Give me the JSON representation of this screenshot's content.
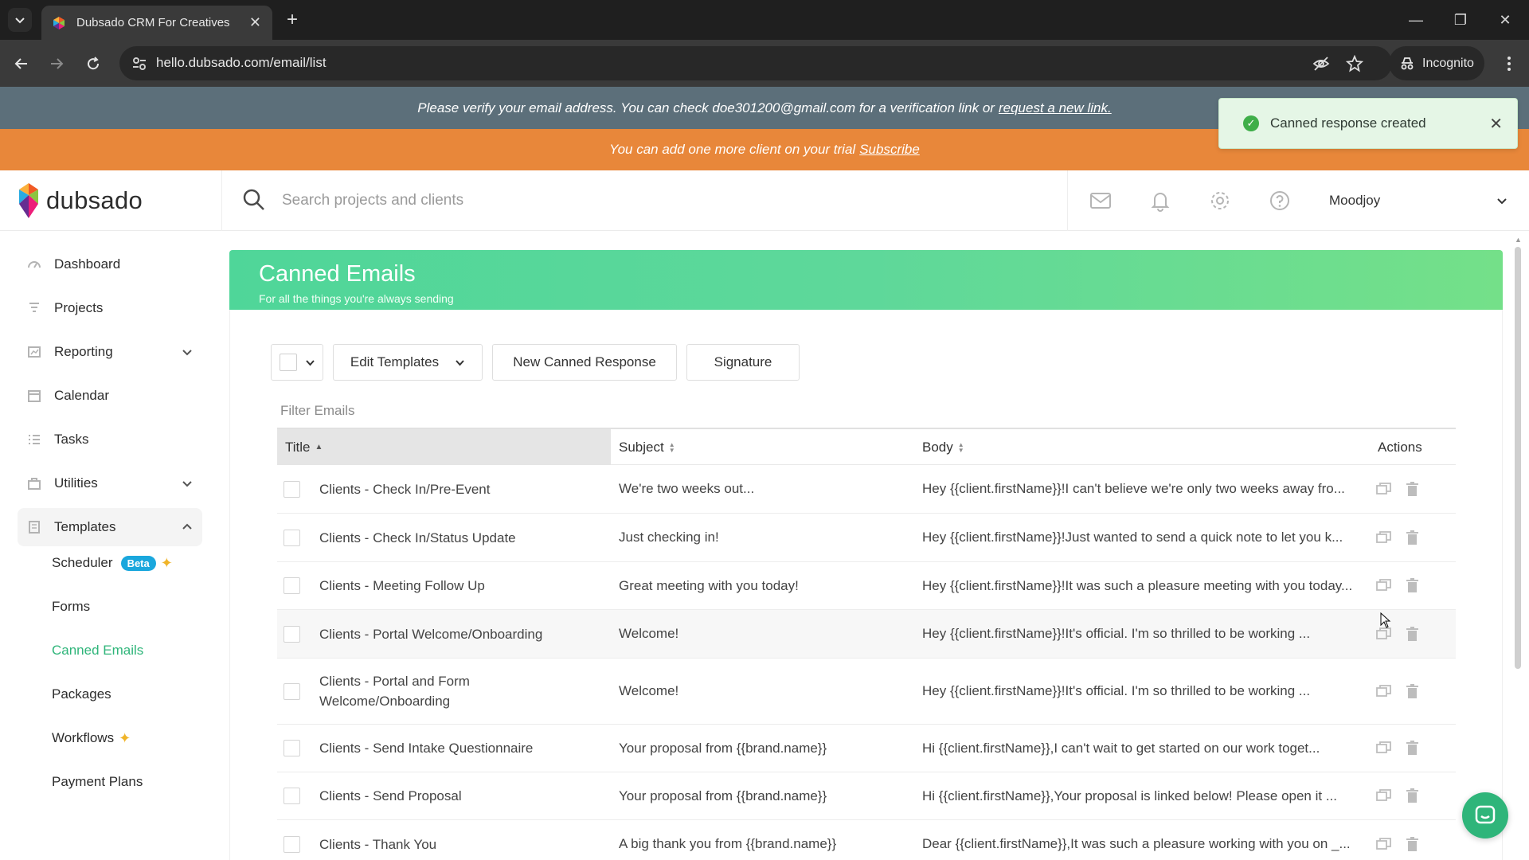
{
  "browser": {
    "tab_title": "Dubsado CRM For Creatives",
    "url": "hello.dubsado.com/email/list",
    "incognito_label": "Incognito"
  },
  "banners": {
    "verify_text": "Please verify your email address. You can check doe301200@gmail.com for a verification link or",
    "verify_link": "request a new link.",
    "trial_text": "You can add one more client on your trial",
    "trial_link": "Subscribe"
  },
  "toast": {
    "message": "Canned response created",
    "color": "#3fae49"
  },
  "header": {
    "logo_text": "dubsado",
    "search_placeholder": "Search projects and clients",
    "user_name": "Moodjoy"
  },
  "sidebar": {
    "items": [
      {
        "label": "Dashboard",
        "icon": "dashboard-icon"
      },
      {
        "label": "Projects",
        "icon": "projects-icon"
      },
      {
        "label": "Reporting",
        "icon": "reporting-icon",
        "expandable": true
      },
      {
        "label": "Calendar",
        "icon": "calendar-icon"
      },
      {
        "label": "Tasks",
        "icon": "tasks-icon"
      },
      {
        "label": "Utilities",
        "icon": "utilities-icon",
        "expandable": true
      },
      {
        "label": "Templates",
        "icon": "templates-icon",
        "expanded": true
      }
    ],
    "sub_items": [
      {
        "label": "Scheduler",
        "badge": "Beta"
      },
      {
        "label": "Forms"
      },
      {
        "label": "Canned Emails",
        "current": true
      },
      {
        "label": "Packages"
      },
      {
        "label": "Workflows"
      },
      {
        "label": "Payment Plans"
      }
    ],
    "accent_color": "#2fb57a"
  },
  "page": {
    "title": "Canned Emails",
    "subtitle": "For all the things you're always sending"
  },
  "toolbar": {
    "edit_templates": "Edit Templates",
    "new_canned_response": "New Canned Response",
    "signature": "Signature"
  },
  "filter_placeholder": "Filter Emails",
  "table": {
    "columns": [
      "Title",
      "Subject",
      "Body",
      "Actions"
    ],
    "sorted_column": "Title",
    "rows": [
      {
        "title": "Clients - Check In/Pre-Event",
        "subject": "We're two weeks out...",
        "body": "Hey {{client.firstName}}!I can't believe we're only two weeks away fro..."
      },
      {
        "title": "Clients - Check In/Status Update",
        "subject": "Just checking in!",
        "body": "Hey {{client.firstName}}!Just wanted to send a quick note to let you k..."
      },
      {
        "title": "Clients - Meeting Follow Up",
        "subject": "Great meeting with you today!",
        "body": "Hey {{client.firstName}}!It was such a pleasure meeting with you today..."
      },
      {
        "title": "Clients - Portal Welcome/Onboarding",
        "subject": "Welcome!",
        "body": "Hey {{client.firstName}}!It's official. I'm so thrilled to be working ..."
      },
      {
        "title": "Clients - Portal and Form Welcome/Onboarding",
        "subject": "Welcome!",
        "body": "Hey {{client.firstName}}!It's official. I'm so thrilled to be working ..."
      },
      {
        "title": "Clients - Send Intake Questionnaire",
        "subject": "Your proposal from {{brand.name}}",
        "body": "Hi {{client.firstName}},I can't wait to get started on our work toget..."
      },
      {
        "title": "Clients - Send Proposal",
        "subject": "Your proposal from {{brand.name}}",
        "body": "Hi {{client.firstName}},Your proposal is linked below! Please open it ..."
      },
      {
        "title": "Clients - Thank You",
        "subject": "A big thank you from {{brand.name}}",
        "body": "Dear {{client.firstName}},It was such a pleasure working with you on _..."
      }
    ]
  }
}
